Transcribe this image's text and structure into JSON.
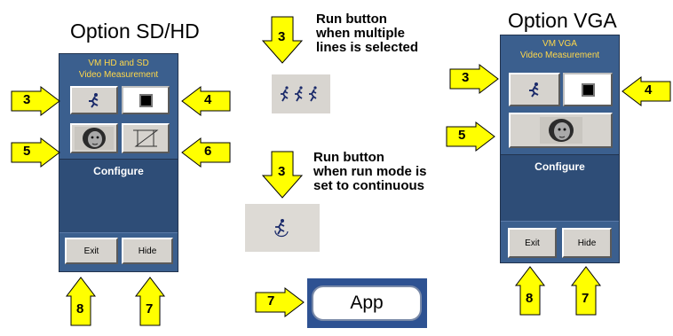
{
  "sd_hd": {
    "heading": "Option SD/HD",
    "panel_title_1": "VM HD and SD",
    "panel_title_2": "Video Measurement",
    "configure": "Configure",
    "exit": "Exit",
    "hide": "Hide"
  },
  "vga": {
    "heading": "Option VGA",
    "panel_title_1": "VM VGA",
    "panel_title_2": "Video Measurement",
    "configure": "Configure",
    "exit": "Exit",
    "hide": "Hide"
  },
  "middle": {
    "note_multiple": "Run button\nwhen multiple\nlines is selected",
    "note_continuous": "Run button\nwhen run mode is\nset to continuous",
    "app_label": "App"
  },
  "callouts": {
    "run": "3",
    "stop": "4",
    "acquire": "5",
    "cursor": "6",
    "hide": "7",
    "exit": "8"
  },
  "colors": {
    "arrow_fill": "#ffff00",
    "panel_blue": "#3b5f8e",
    "title_yellow": "#ffd84a"
  }
}
